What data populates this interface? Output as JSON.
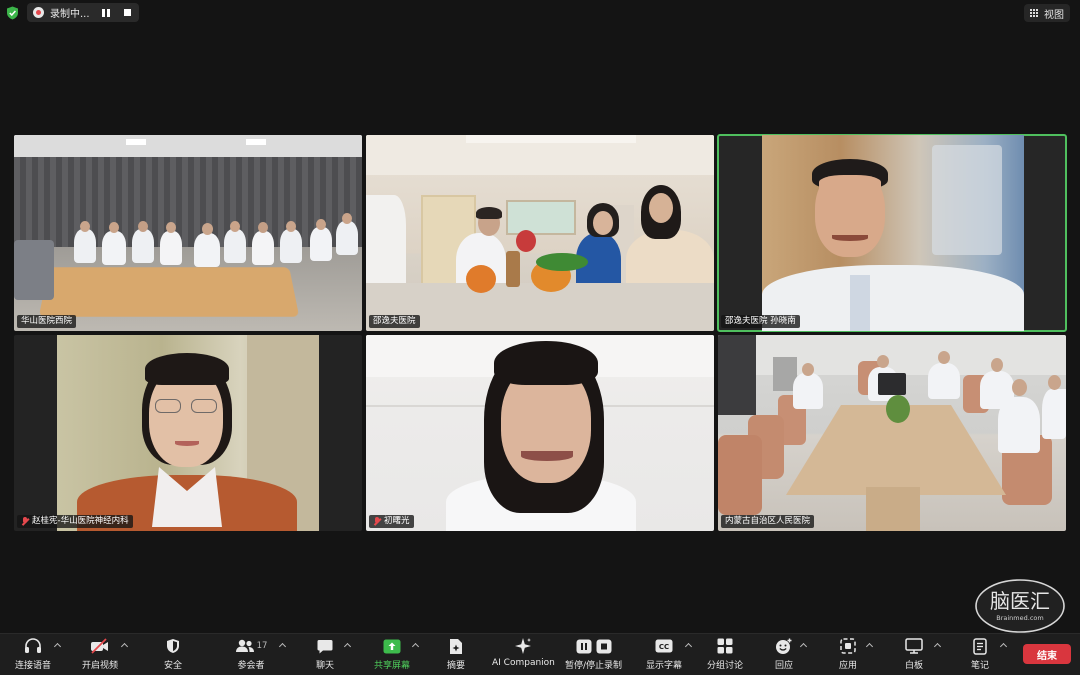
{
  "topbar": {
    "recording_label": "录制中...",
    "view_label": "视图"
  },
  "tiles": [
    {
      "name": "华山医院西院",
      "muted": false,
      "active": false
    },
    {
      "name": "邵逸夫医院",
      "muted": false,
      "active": false
    },
    {
      "name": "邵逸夫医院 孙晓南",
      "muted": false,
      "active": true
    },
    {
      "name": "赵桂宪-华山医院神经内科",
      "muted": true,
      "active": false
    },
    {
      "name": "初曙光",
      "muted": true,
      "active": false
    },
    {
      "name": "内蒙古自治区人民医院",
      "muted": false,
      "active": false
    }
  ],
  "toolbar": {
    "audio": "连接语音",
    "video": "开启视频",
    "security": "安全",
    "participants": "参会者",
    "participants_count": "17",
    "chat": "聊天",
    "share": "共享屏幕",
    "summary": "摘要",
    "ai": "AI Companion",
    "record": "暂停/停止录制",
    "captions": "显示字幕",
    "breakout": "分组讨论",
    "reactions": "回应",
    "apps": "应用",
    "whiteboard": "白板",
    "notes": "笔记",
    "end": "结束"
  },
  "watermark": {
    "text": "脑医汇",
    "sub": "Brainmed.com"
  },
  "colors": {
    "active_border": "#4fbf5e",
    "end_button": "#d9363e",
    "share_green": "#4fd05c"
  }
}
